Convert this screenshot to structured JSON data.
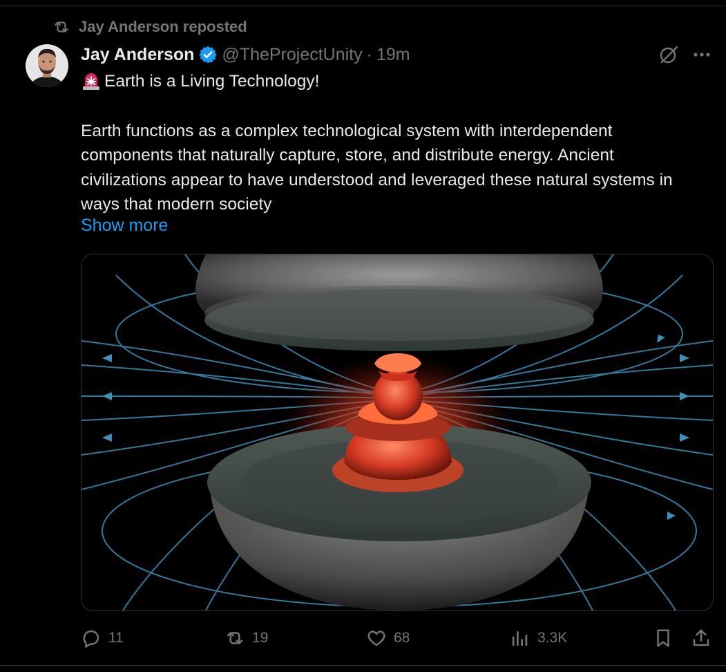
{
  "repost": {
    "text": "Jay Anderson reposted"
  },
  "author": {
    "name": "Jay Anderson",
    "handle": "@TheProjectUnity",
    "separator": "·",
    "time": "19m"
  },
  "post": {
    "headline": "Earth is a Living Technology!",
    "body": "Earth functions as a complex technological system with interdependent components that naturally capture, store, and distribute energy. Ancient civilizations appear to have understood and leveraged these natural systems in ways that modern society",
    "show_more": "Show more"
  },
  "media": {
    "icon": "earth-core-magnetic-field-illustration"
  },
  "metrics": {
    "replies": "11",
    "reposts": "19",
    "likes": "68",
    "views": "3.3K"
  },
  "colors": {
    "accent": "#1d9bf0",
    "muted": "#71767b",
    "text": "#e7e9ea",
    "border": "#2f3336"
  }
}
